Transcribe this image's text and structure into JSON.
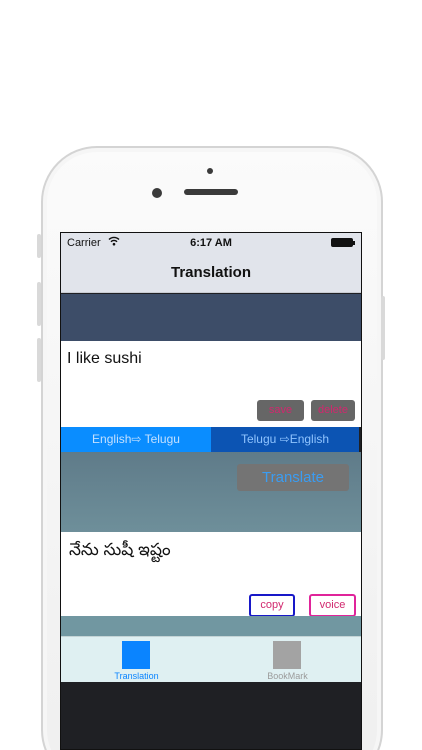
{
  "status_bar": {
    "carrier": "Carrier",
    "wifi_icon": "wifi-icon",
    "time": "6:17 AM",
    "battery_icon": "battery-icon"
  },
  "nav": {
    "title": "Translation"
  },
  "input": {
    "text": "I like sushi",
    "save_label": "save",
    "delete_label": "delete"
  },
  "languages": {
    "left": "English⇨ Telugu",
    "right": "Telugu  ⇨English"
  },
  "translate_label": "Translate",
  "output": {
    "text": "నేను సుషీ ఇష్టం",
    "copy_label": "copy",
    "voice_label": "voice"
  },
  "tabs": [
    {
      "label": "Translation",
      "selected": true,
      "color": "#0a84ff"
    },
    {
      "label": "BookMark",
      "selected": false,
      "color": "#a3a3a3"
    }
  ],
  "colors": {
    "accent": "#0a84ff",
    "button_text": "#d1286e",
    "header_strip": "#3d4d68"
  }
}
